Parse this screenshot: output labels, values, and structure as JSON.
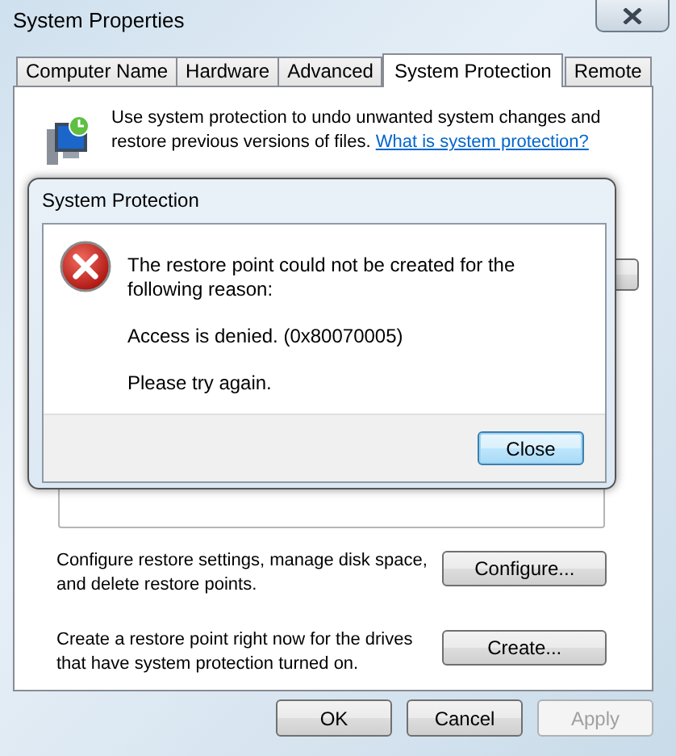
{
  "window": {
    "title": "System Properties"
  },
  "tabs": [
    {
      "label": "Computer Name",
      "selected": false
    },
    {
      "label": "Hardware",
      "selected": false
    },
    {
      "label": "Advanced",
      "selected": false
    },
    {
      "label": "System Protection",
      "selected": true
    },
    {
      "label": "Remote",
      "selected": false
    }
  ],
  "intro": {
    "text": "Use system protection to undo unwanted system changes and restore previous versions of files.",
    "link": "What is system protection?"
  },
  "actions": [
    {
      "text": "Configure restore settings, manage disk space, and delete restore points.",
      "button": "Configure..."
    },
    {
      "text": "Create a restore point right now for the drives that have system protection turned on.",
      "button": "Create..."
    }
  ],
  "buttons": [
    {
      "label": "OK",
      "disabled": false
    },
    {
      "label": "Cancel",
      "disabled": false
    },
    {
      "label": "Apply",
      "disabled": true
    }
  ],
  "dialog": {
    "title": "System Protection",
    "message": "The restore point could not be created for the following reason:",
    "detail": "Access is denied. (0x80070005)",
    "hint": "Please try again.",
    "buttons": [
      "Close"
    ]
  }
}
